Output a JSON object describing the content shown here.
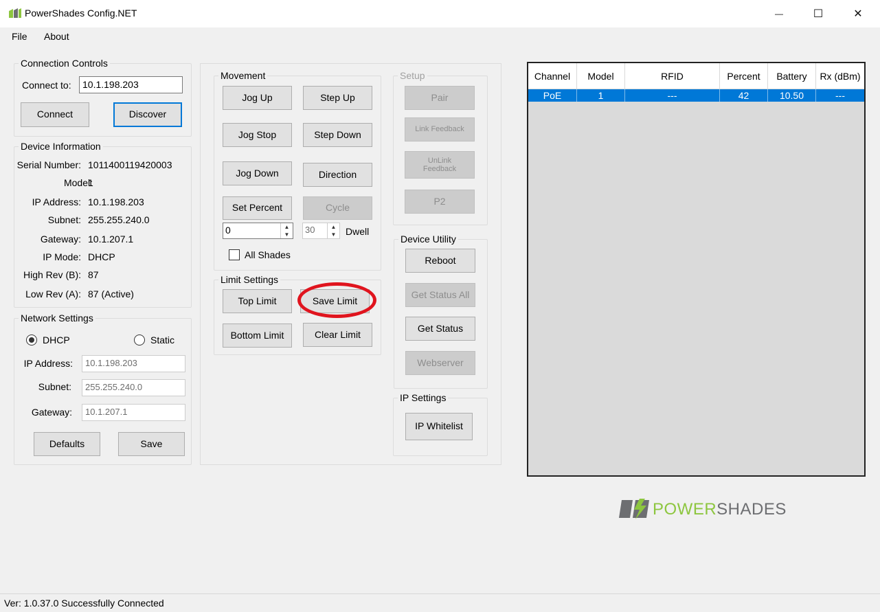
{
  "window": {
    "title": "PowerShades Config.NET",
    "minimize_glyph": "—",
    "maximize_glyph": "☐",
    "close_glyph": "✕"
  },
  "menu": {
    "file": "File",
    "about": "About"
  },
  "connection": {
    "group_label": "Connection Controls",
    "connect_to_label": "Connect to:",
    "connect_to_value": "10.1.198.203",
    "connect_button": "Connect",
    "discover_button": "Discover"
  },
  "device_info": {
    "group_label": "Device Information",
    "rows": [
      {
        "label": "Serial Number:",
        "value": "1011400119420003"
      },
      {
        "label": "Model:",
        "value": "1"
      },
      {
        "label": "IP Address:",
        "value": "10.1.198.203"
      },
      {
        "label": "Subnet:",
        "value": "255.255.240.0"
      },
      {
        "label": "Gateway:",
        "value": "10.1.207.1"
      },
      {
        "label": "IP Mode:",
        "value": "DHCP"
      },
      {
        "label": "High Rev (B):",
        "value": "87"
      },
      {
        "label": "Low Rev (A):",
        "value": "87 (Active)"
      }
    ]
  },
  "network": {
    "group_label": "Network Settings",
    "dhcp_label": "DHCP",
    "dhcp_selected": true,
    "static_label": "Static",
    "ip_label": "IP Address:",
    "ip_value": "10.1.198.203",
    "subnet_label": "Subnet:",
    "subnet_value": "255.255.240.0",
    "gateway_label": "Gateway:",
    "gateway_value": "10.1.207.1",
    "defaults_button": "Defaults",
    "save_button": "Save"
  },
  "movement": {
    "group_label": "Movement",
    "jog_up": "Jog Up",
    "step_up": "Step Up",
    "jog_stop": "Jog Stop",
    "step_down": "Step Down",
    "jog_down": "Jog Down",
    "direction": "Direction",
    "set_percent": "Set Percent",
    "cycle": "Cycle",
    "percent_value": "0",
    "dwell_value": "30",
    "dwell_label": "Dwell",
    "all_shades_label": "All Shades"
  },
  "limits": {
    "group_label": "Limit Settings",
    "top_limit": "Top Limit",
    "save_limit": "Save Limit",
    "bottom_limit": "Bottom Limit",
    "clear_limit": "Clear Limit"
  },
  "setup": {
    "group_label": "Setup",
    "pair": "Pair",
    "link_feedback": "Link Feedback",
    "unlink_feedback_1": "UnLink",
    "unlink_feedback_2": "Feedback",
    "p2": "P2"
  },
  "device_utility": {
    "group_label": "Device Utility",
    "reboot": "Reboot",
    "get_status_all": "Get Status All",
    "get_status": "Get Status",
    "webserver": "Webserver"
  },
  "ip_settings": {
    "group_label": "IP Settings",
    "ip_whitelist": "IP Whitelist"
  },
  "grid": {
    "columns": [
      "Channel",
      "Model",
      "RFID",
      "Percent",
      "Battery",
      "Rx (dBm)"
    ],
    "rows": [
      [
        "PoE",
        "1",
        "---",
        "42",
        "10.50",
        "---"
      ]
    ]
  },
  "logo": {
    "text_power": "POWER",
    "text_shades": "SHADES"
  },
  "status": {
    "text": "Ver: 1.0.37.0  Successfully Connected"
  },
  "colors": {
    "accent": "#0078d7",
    "highlight_ring": "#e0141e",
    "logo_green": "#8dc63f",
    "logo_gray": "#6d6e71"
  }
}
